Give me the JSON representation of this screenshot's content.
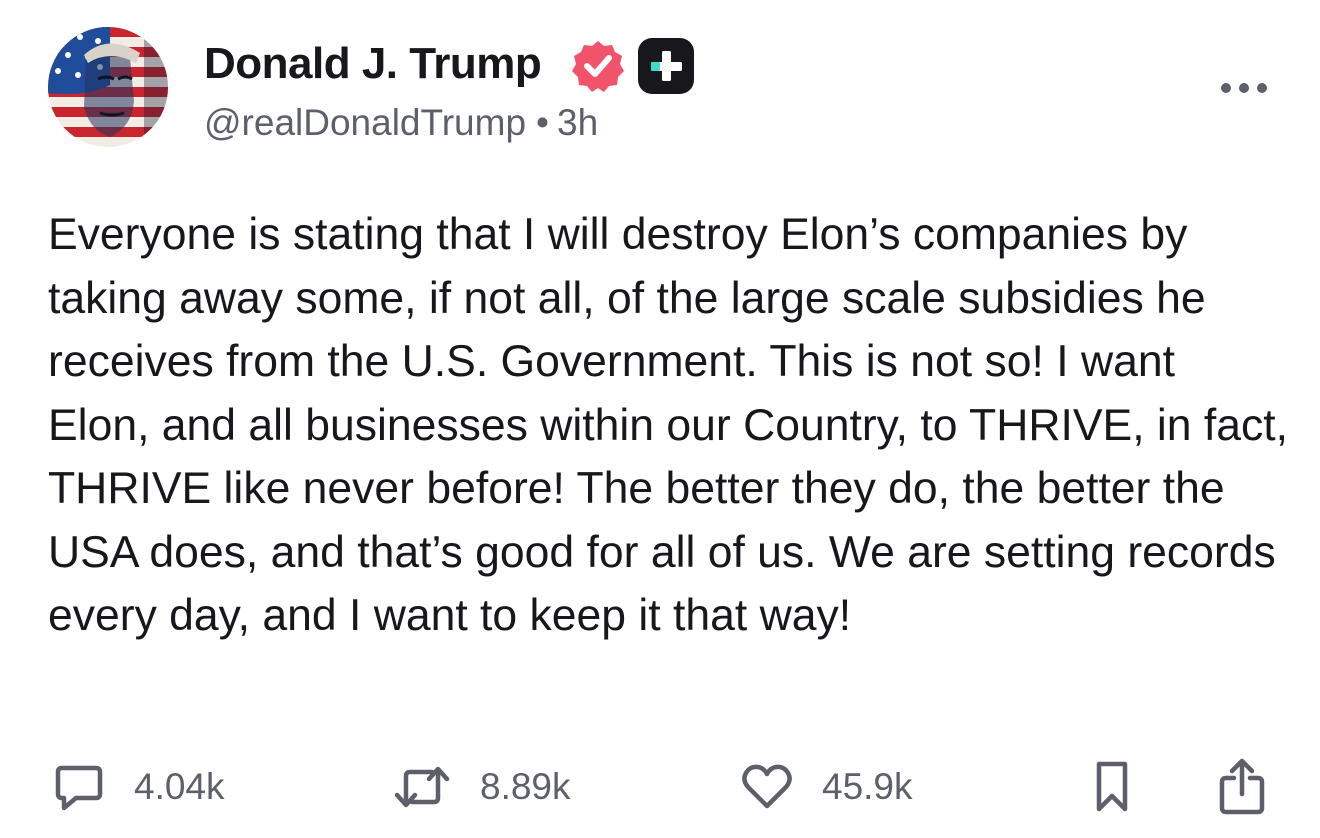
{
  "author": {
    "display_name": "Donald J. Trump",
    "handle": "@realDonaldTrump",
    "separator": "•",
    "time_ago": "3h",
    "verified_icon": "verified-badge-icon",
    "plus_icon": "truth-plus-icon"
  },
  "post": {
    "text": "Everyone is stating that I will destroy Elon’s companies by taking away some, if not all, of the large scale subsidies he receives from the U.S. Government. This is not so! I want Elon, and all businesses within our Country, to THRIVE, in fact, THRIVE like never before! The better they do, the better the USA does, and that’s good for all of us. We are setting records every day, and I want to keep it that way!"
  },
  "actions": {
    "replies": "4.04k",
    "restruths": "8.89k",
    "likes": "45.9k"
  },
  "colors": {
    "verified": "#f0536a",
    "text": "#17171c",
    "secondary_text": "#5d5f6b",
    "plus_accent": "#3ddcc8"
  }
}
